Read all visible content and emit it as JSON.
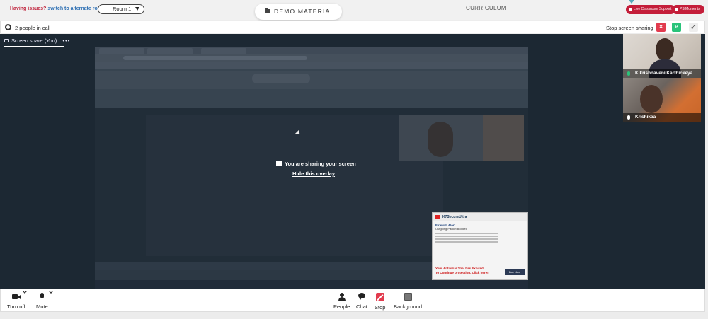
{
  "topbar": {
    "issues_text": "Having issues?",
    "switch_room_link": "switch to alternate room",
    "room_selected": "Room 1",
    "demo_material_label": "DEMO MATERIAL",
    "curriculum_label": "CURRICULUM",
    "live_support_label": "Live Classroom Support",
    "ps_moments_label": "PS Moments"
  },
  "callbar": {
    "people_in_call": "2 people in call",
    "stop_screen_sharing": "Stop screen sharing",
    "participant_initial": "P"
  },
  "stage": {
    "share_tab_label": "Screen share (You)",
    "share_tab_more": "•••",
    "overlay_message": "You are sharing your screen",
    "overlay_hide_link": "Hide this overlay"
  },
  "antivirus_popup": {
    "brand": "K7SecureUltra",
    "title": "Firewall Alert",
    "subtitle": "Outgoing Packet Blocked",
    "warning_line1": "Your Antivirus Trial has Expired!",
    "warning_line2": "To Continue protection, Click here!",
    "buy_button": "Buy Now"
  },
  "participants": [
    {
      "name": "K.krishnaveni Karthickeya...",
      "mic": "active"
    },
    {
      "name": "Krishikaa",
      "mic": "on"
    }
  ],
  "toolbar": {
    "camera_label": "Turn off",
    "mute_label": "Mute",
    "people_label": "People",
    "chat_label": "Chat",
    "stop_label": "Stop",
    "background_label": "Background"
  },
  "colors": {
    "accent_red": "#c41e3a",
    "stop_red": "#e23b4e",
    "active_green": "#29c37a",
    "stage_bg": "#1c2833"
  }
}
